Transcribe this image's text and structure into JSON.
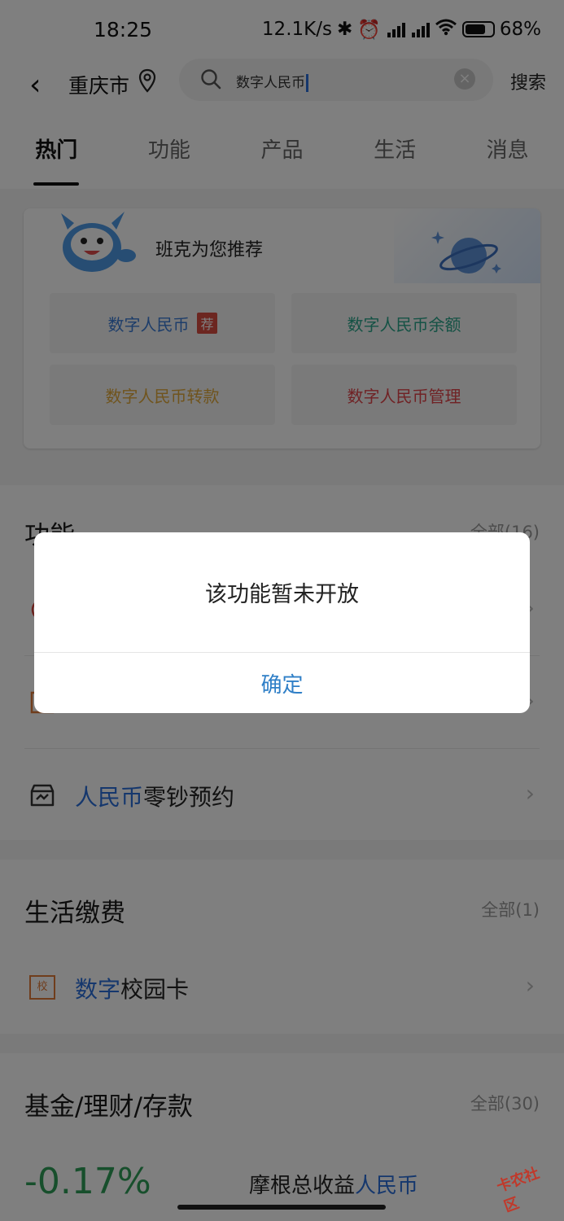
{
  "status_bar": {
    "time": "18:25",
    "net_speed": "12.1K/s",
    "battery": "68%"
  },
  "header": {
    "back": "‹",
    "city": "重庆市",
    "search_value": "数字人民币",
    "search_button": "搜索"
  },
  "tabs": [
    {
      "label": "热门",
      "active": true
    },
    {
      "label": "功能",
      "active": false
    },
    {
      "label": "产品",
      "active": false
    },
    {
      "label": "生活",
      "active": false
    },
    {
      "label": "消息",
      "active": false
    }
  ],
  "recommend": {
    "title": "班克为您推荐",
    "items": [
      {
        "label": "数字人民币",
        "color": "#3a7bd5",
        "badge": "荐"
      },
      {
        "label": "数字人民币余额",
        "color": "#2aa58a"
      },
      {
        "label": "数字人民币转款",
        "color": "#e0a93a"
      },
      {
        "label": "数字人民币管理",
        "color": "#e0454a"
      }
    ]
  },
  "features": {
    "title": "功能",
    "all": "全部(16)",
    "rows": [
      {
        "highlight": "",
        "rest": ""
      },
      {
        "highlight": "",
        "rest": ""
      },
      {
        "highlight": "人民币",
        "rest": "零钞预约"
      }
    ]
  },
  "life": {
    "title": "生活缴费",
    "all": "全部(1)",
    "rows": [
      {
        "highlight": "数字",
        "rest": "校园卡",
        "icon_text": "校"
      }
    ]
  },
  "fund": {
    "title": "基金/理财/存款",
    "all": "全部(30)",
    "pct": "-0.17%",
    "name_prefix": "摩根总收益",
    "name_highlight": "人民币"
  },
  "dialog": {
    "message": "该功能暂未开放",
    "confirm": "确定"
  },
  "watermark": {
    "text": "卡农社区"
  }
}
